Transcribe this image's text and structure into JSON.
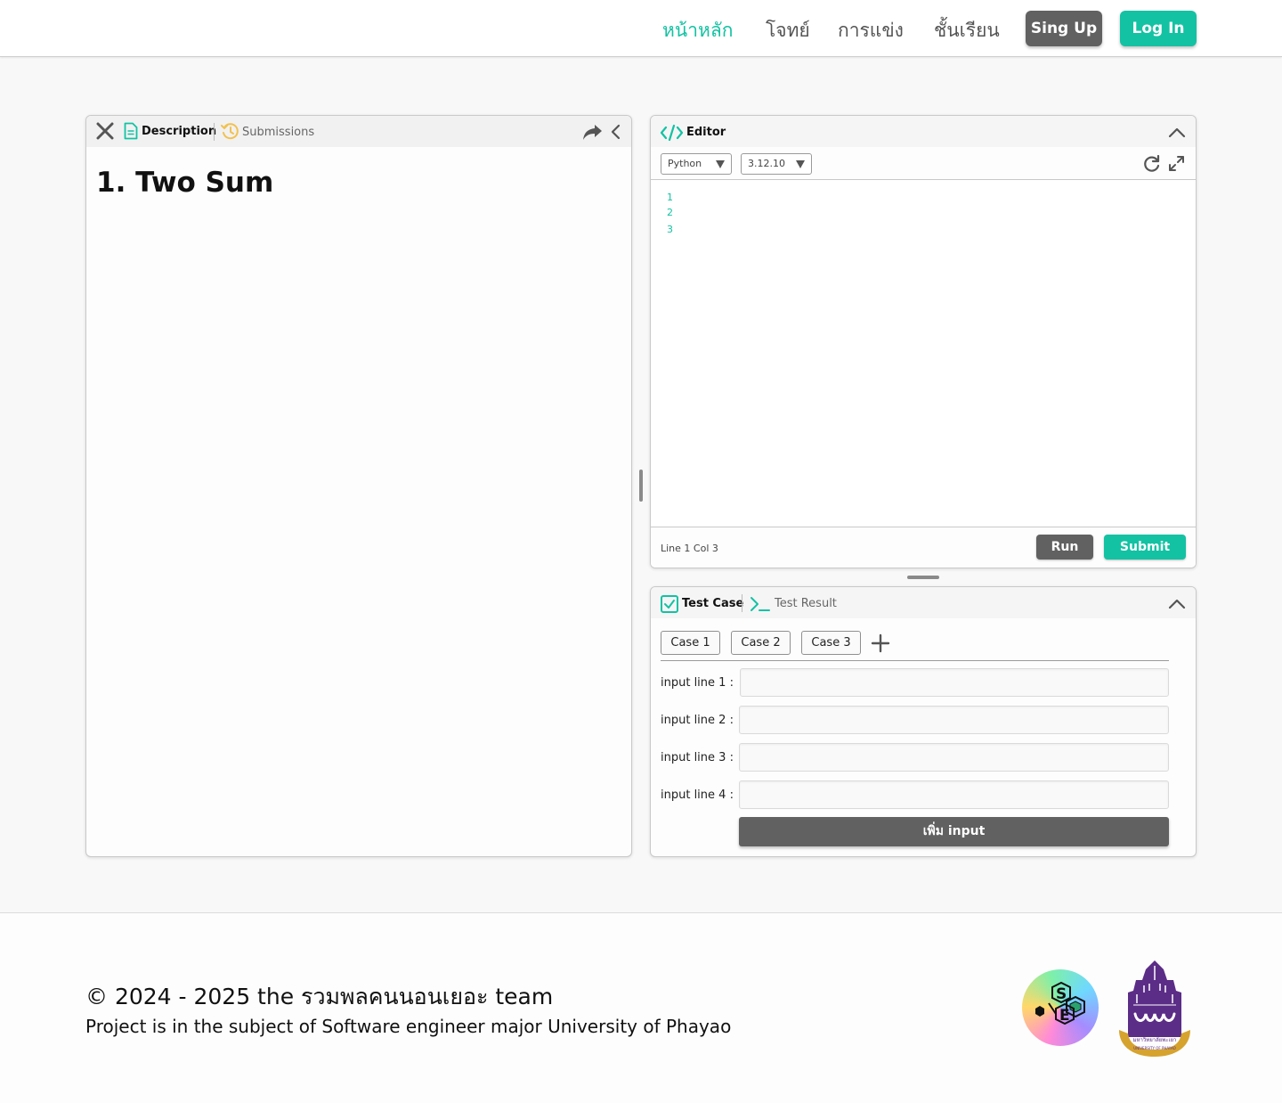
{
  "nav": {
    "links": [
      "หน้าหลัก",
      "โจทย์",
      "การแข่ง",
      "ชั้นเรียน"
    ],
    "signup_label": "Sing Up",
    "login_label": "Log In",
    "accent_color": "#13c2a3",
    "dark_button_color": "#616161"
  },
  "problem_panel": {
    "tabs": {
      "description": "Description",
      "submissions": "Submissions"
    },
    "title": "1. Two Sum"
  },
  "editor_panel": {
    "title": "Editor",
    "language": "Python",
    "version": "3.12.10",
    "line_numbers": [
      "1",
      "2",
      "3"
    ],
    "status": "Line 1 Col 3",
    "run_label": "Run",
    "submit_label": "Submit"
  },
  "testcase_panel": {
    "tabs": {
      "test_case": "Test Case",
      "test_result": "Test Result"
    },
    "cases": [
      "Case 1",
      "Case 2",
      "Case 3"
    ],
    "inputs": [
      "input line 1 :",
      "input line 2 :",
      "input line 3 :",
      "input line 4 :"
    ],
    "add_input_label": "เพิ่ม input"
  },
  "footer": {
    "copyright": "© 2024 - 2025 the รวมพลคนนอนเยอะ team",
    "subtitle": "Project is in the subject of Software engineer major University of Phayao",
    "se_logo_letters": [
      "S",
      "E"
    ],
    "university_logo_text": "มหาวิทยาลัยพะเยา",
    "university_logo_subtext": "UNIVERSITY OF PHAYAO"
  }
}
